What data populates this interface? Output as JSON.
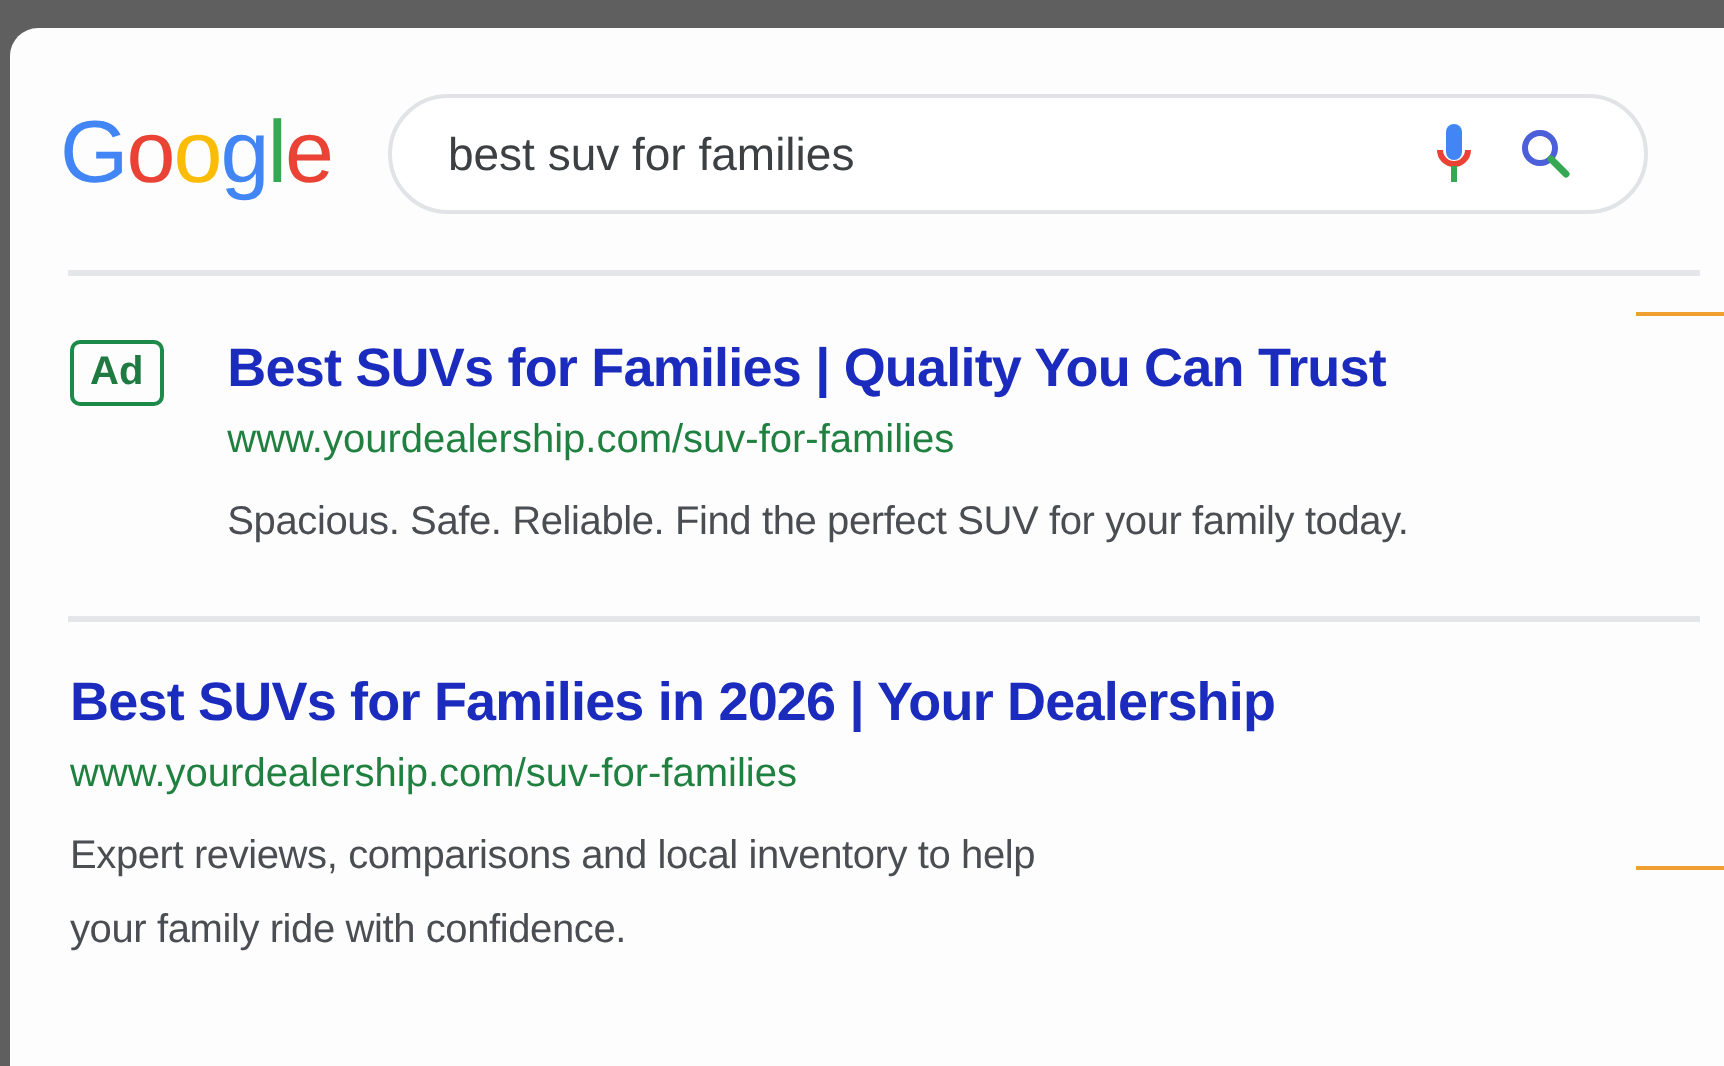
{
  "logo": "Google",
  "search": {
    "value": "best suv for families"
  },
  "results": [
    {
      "kind": "ad",
      "badge": "Ad",
      "title": "Best SUVs for Families | Quality You Can Trust",
      "url": "www.yourdealership.com/suv-for-families",
      "description": [
        "Spacious. Safe. Reliable. Find the perfect SUV for your family today."
      ]
    },
    {
      "kind": "organic",
      "title": "Best SUVs for Families in 2026 | Your Dealership",
      "url": "www.yourdealership.com/suv-for-families",
      "description": [
        "Expert reviews, comparisons and local inventory to help",
        "your family ride with confidence."
      ]
    }
  ]
}
